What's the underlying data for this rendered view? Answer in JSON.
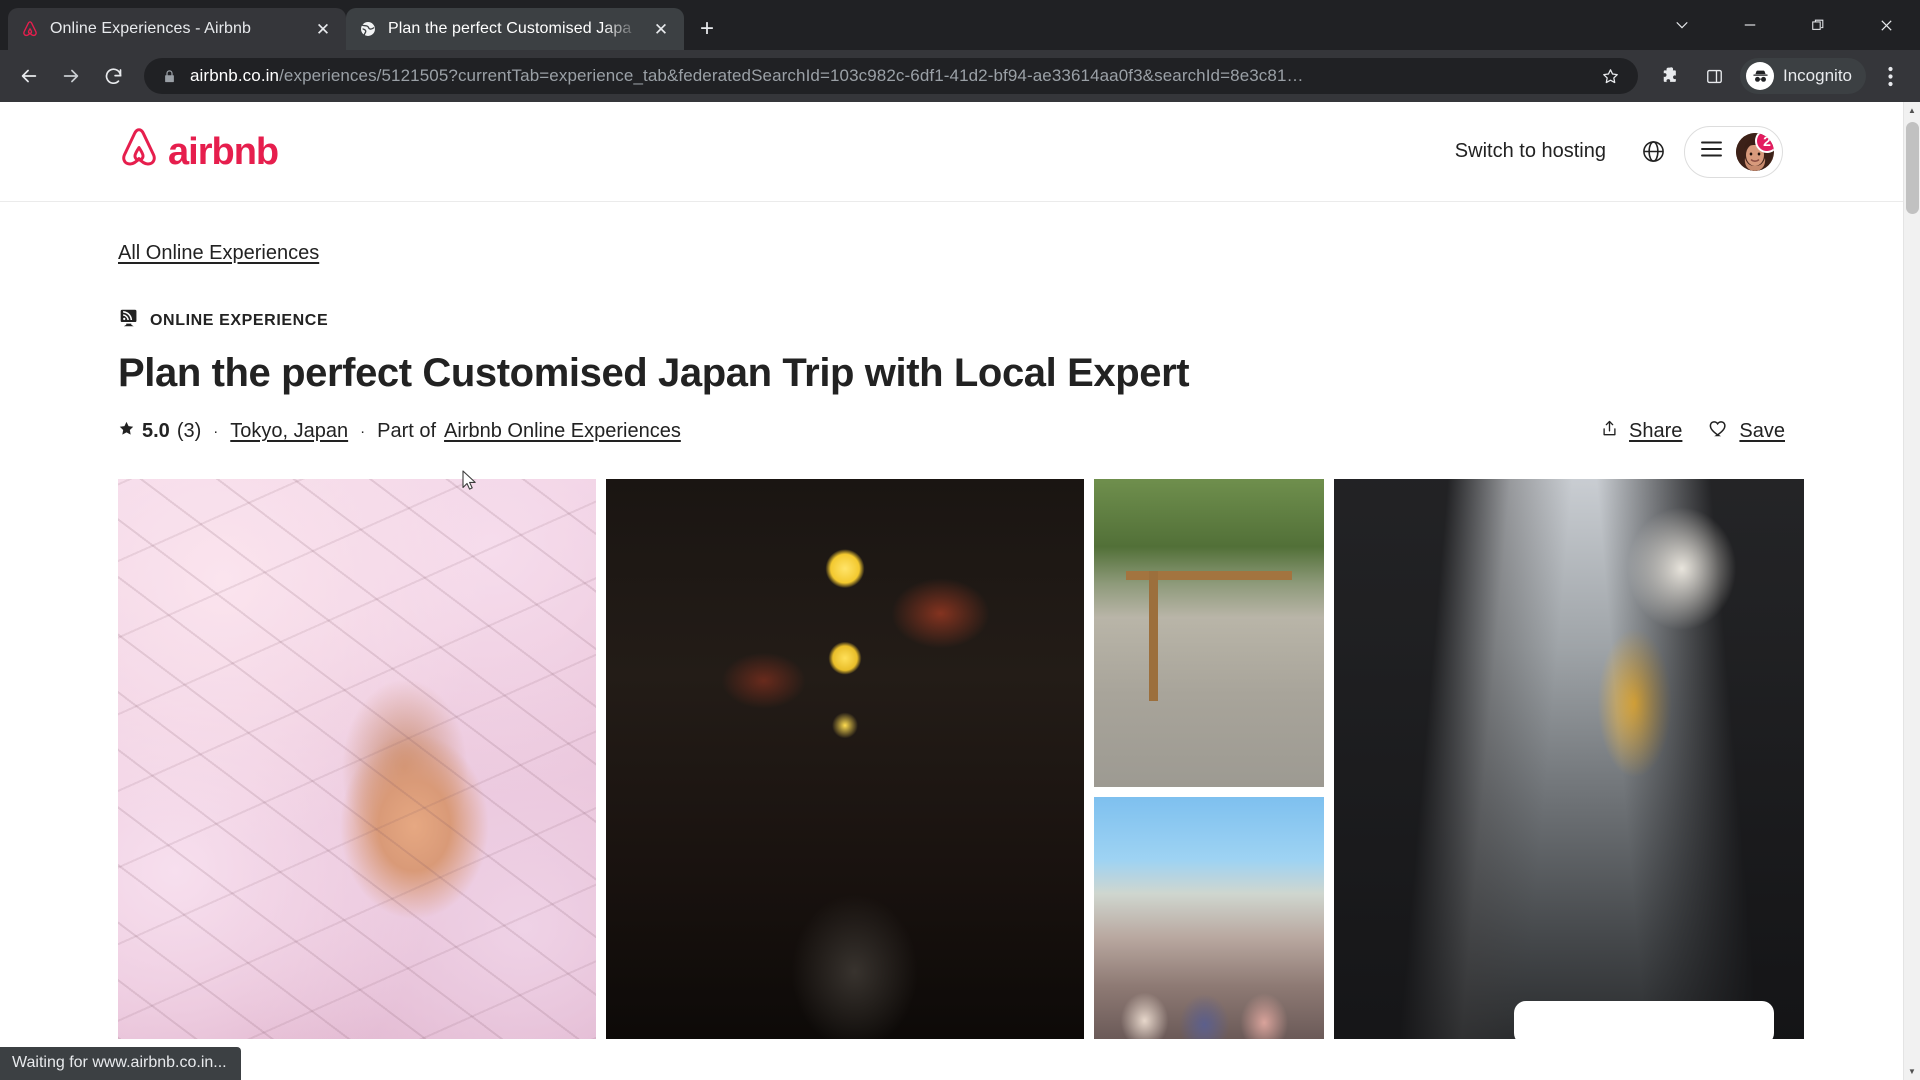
{
  "browser": {
    "tabs": [
      {
        "title": "Online Experiences - Airbnb",
        "favicon": "airbnb-icon",
        "active": false
      },
      {
        "title": "Plan the perfect Customised Japa",
        "favicon": "globe-icon",
        "active": true
      }
    ],
    "new_tab_label": "+",
    "close_label": "✕",
    "window_controls": [
      "tab-search-chevron-icon",
      "minimize-icon",
      "restore-icon",
      "close-icon"
    ],
    "nav": {
      "back": "back-arrow-icon",
      "forward": "forward-arrow-icon",
      "reload": "reload-icon"
    },
    "omnibox": {
      "lock": "lock-icon",
      "host": "airbnb.co.in",
      "path": "/experiences/5121505?currentTab=experience_tab&federatedSearchId=103c982c-6df1-41d2-bf94-ae33614aa0f3&searchId=8e3c81…",
      "bookmark_icon": "star-icon"
    },
    "toolbar_icons": [
      "extensions-puzzle-icon",
      "side-panel-icon"
    ],
    "incognito_label": "Incognito",
    "menu_icon": "three-dot-menu-icon",
    "status_text": "Waiting for www.airbnb.co.in..."
  },
  "header": {
    "logo_text": "airbnb",
    "logo_icon": "airbnb-bélo-icon",
    "switch_hosting": "Switch to hosting",
    "globe_icon": "globe-icon",
    "menu_icon": "hamburger-menu-icon",
    "avatar": "user-avatar",
    "notification_count": "2"
  },
  "page": {
    "breadcrumb": "All Online Experiences",
    "badge_icon": "online-experience-icon",
    "badge_label": "ONLINE EXPERIENCE",
    "title": "Plan the perfect Customised Japan Trip with Local Expert",
    "rating": {
      "star_icon": "star-filled-icon",
      "value": "5.0",
      "reviews": "(3)"
    },
    "separator": "·",
    "location": "Tokyo, Japan",
    "part_of_prefix": "Part of",
    "part_of_link": "Airbnb Online Experiences",
    "share": {
      "icon": "share-upload-icon",
      "label": "Share"
    },
    "save": {
      "icon": "heart-outline-icon",
      "label": "Save"
    },
    "gallery": [
      {
        "name": "photo-cherry-blossom-portrait",
        "alt": "Woman under cherry blossom tree"
      },
      {
        "name": "photo-night-alley-lanterns",
        "alt": "Narrow Tokyo alley with lanterns at night"
      },
      {
        "name": "photo-torii-gate-group",
        "alt": "Group in front of torii gate"
      },
      {
        "name": "photo-temple-street-group",
        "alt": "Group at Senso-ji temple street"
      },
      {
        "name": "photo-shopping-street",
        "alt": "Tokyo shopping street alleyway"
      }
    ]
  },
  "colors": {
    "brand": "#e61e4d",
    "badge": "#e31c5f",
    "text": "#222222",
    "chrome_dark": "#202124",
    "chrome_toolbar": "#35363a"
  },
  "scrollbar": {
    "up": "▲",
    "down": "▼"
  }
}
